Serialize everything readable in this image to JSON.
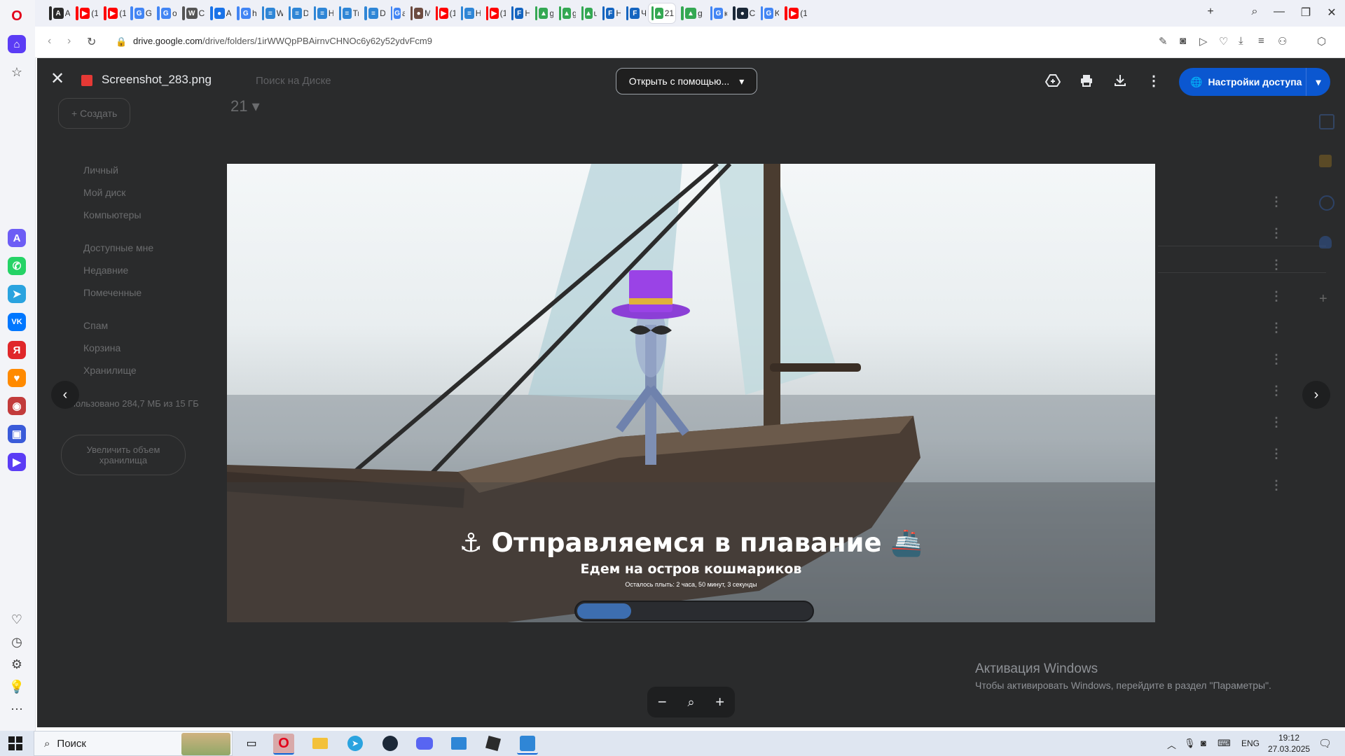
{
  "browser": {
    "tabs": [
      {
        "title": "А",
        "fav": "A",
        "color": "#2a2a2a"
      },
      {
        "title": "(1",
        "fav": "▶",
        "color": "#ff0000"
      },
      {
        "title": "(1",
        "fav": "▶",
        "color": "#ff0000"
      },
      {
        "title": "G",
        "fav": "G",
        "color": "#4285f4"
      },
      {
        "title": "o",
        "fav": "G",
        "color": "#4285f4"
      },
      {
        "title": "C",
        "fav": "W",
        "color": "#555555"
      },
      {
        "title": "А",
        "fav": "●",
        "color": "#1a73e8"
      },
      {
        "title": "h",
        "fav": "G",
        "color": "#4285f4"
      },
      {
        "title": "W",
        "fav": "≡",
        "color": "#2f86d6"
      },
      {
        "title": "D",
        "fav": "≡",
        "color": "#2f86d6"
      },
      {
        "title": "H",
        "fav": "≡",
        "color": "#2f86d6"
      },
      {
        "title": "Tr",
        "fav": "≡",
        "color": "#2f86d6"
      },
      {
        "title": "D",
        "fav": "≡",
        "color": "#2f86d6"
      },
      {
        "title": "a",
        "fav": "G",
        "color": "#4285f4"
      },
      {
        "title": "M",
        "fav": "●",
        "color": "#6d4c41"
      },
      {
        "title": "(1",
        "fav": "▶",
        "color": "#ff0000"
      },
      {
        "title": "H",
        "fav": "≡",
        "color": "#2f86d6"
      },
      {
        "title": "(1",
        "fav": "▶",
        "color": "#ff0000"
      },
      {
        "title": "H",
        "fav": "F",
        "color": "#1565c0"
      },
      {
        "title": "g",
        "fav": "▲",
        "color": "#34a853"
      },
      {
        "title": "g",
        "fav": "▲",
        "color": "#34a853"
      },
      {
        "title": "u",
        "fav": "▲",
        "color": "#34a853"
      },
      {
        "title": "H",
        "fav": "F",
        "color": "#1565c0"
      },
      {
        "title": "Ч",
        "fav": "F",
        "color": "#1565c0"
      },
      {
        "title": "21 -",
        "fav": "▲",
        "color": "#34a853"
      },
      {
        "title": "g",
        "fav": "▲",
        "color": "#34a853"
      },
      {
        "title": "к",
        "fav": "G",
        "color": "#4285f4"
      },
      {
        "title": "C",
        "fav": "●",
        "color": "#1b2838"
      },
      {
        "title": "K",
        "fav": "G",
        "color": "#4285f4"
      },
      {
        "title": "(1",
        "fav": "▶",
        "color": "#ff0000"
      }
    ],
    "url_domain": "drive.google.com",
    "url_path": "/drive/folders/1irWWQpPBAirnvCHNOc6y62y52ydvFcm9"
  },
  "viewer": {
    "file_name": "Screenshot_283.png",
    "open_with_label": "Открыть с помощью...",
    "share_label": "Настройки доступа",
    "search_placeholder": "Поиск на Диске"
  },
  "drive_bg": {
    "create_label": "Создать",
    "folder_title": "21",
    "nav_items": [
      "Личный",
      "Мой диск",
      "Компьютеры",
      "Доступные мне",
      "Недавние",
      "Помеченные",
      "Спам",
      "Корзина",
      "Хранилище"
    ],
    "storage_text": "Использовано 284,7 МБ из 15 ГБ",
    "upgrade_label": "Увеличить объем хранилища"
  },
  "image_content": {
    "title": "⚓ Отправляемся в плавание 🚢",
    "subtitle": "Едем на остров кошмариков",
    "remaining": "Осталось плыть: 2 часа, 50 минут, 3 секунды",
    "progress_fraction": 0.23
  },
  "watermark": {
    "title": "Активация Windows",
    "subtitle": "Чтобы активировать Windows, перейдите в раздел \"Параметры\"."
  },
  "taskbar": {
    "search_label": "Поиск",
    "lang": "ENG",
    "time": "19:12",
    "date": "27.03.2025"
  }
}
